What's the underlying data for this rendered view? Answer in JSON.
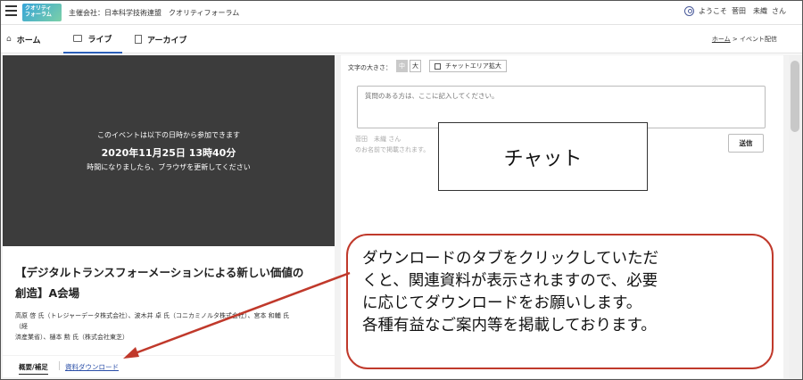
{
  "header": {
    "logo_line1": "クオリティ",
    "logo_line2": "フォーラム",
    "organizer": "主催会社：日本科学技術連盟　クオリティフォーラム",
    "welcome": "ようこそ",
    "user_name": "菅田　未織",
    "honorific": "さん"
  },
  "nav": {
    "tabs": [
      {
        "label": "ホーム",
        "icon": "home-icon"
      },
      {
        "label": "ライブ",
        "icon": "video-icon",
        "active": true
      },
      {
        "label": "アーカイブ",
        "icon": "film-icon"
      }
    ],
    "breadcrumb": {
      "home": "ホーム",
      "separator": " > ",
      "current": "イベント配信"
    }
  },
  "video": {
    "notice": "このイベントは以下の日時から参加できます",
    "datetime": "2020年11月25日 13時40分",
    "refresh": "時間になりましたら、ブラウザを更新してください"
  },
  "event": {
    "title_line1": "【デジタルトランスフォーメーションによる新しい価値の",
    "title_line2": "創造】A会場",
    "speakers_line1": "高原 啓 氏（トレジャーデータ株式会社）、波木井 卓 氏（コニカミノルタ株式会社）、宮本 和輔 氏（経",
    "speakers_line2": "済産業省）、樋本 勲 氏（株式会社東芝）",
    "tabs": {
      "overview": "概要/補足",
      "download": "資料ダウンロード"
    }
  },
  "chat": {
    "font_size_label": "文字の大きさ：",
    "size_medium": "中",
    "size_large": "大",
    "expand_label": "チャットエリア拡大",
    "placeholder": "質問のある方は、ここに記入してください。",
    "poster_name": "菅田　未織 さん",
    "poster_note": "のお名前で掲載されます。",
    "send_label": "送信"
  },
  "overlay": {
    "chat_label": "チャット",
    "callout_lines": [
      "ダウンロードのタブをクリックしていただ",
      "くと、関連資料が表示されますので、必要",
      "に応じてダウンロードをお願いします。",
      "各種有益なご案内等を掲載しております。"
    ],
    "accent_color": "#c0392b"
  }
}
